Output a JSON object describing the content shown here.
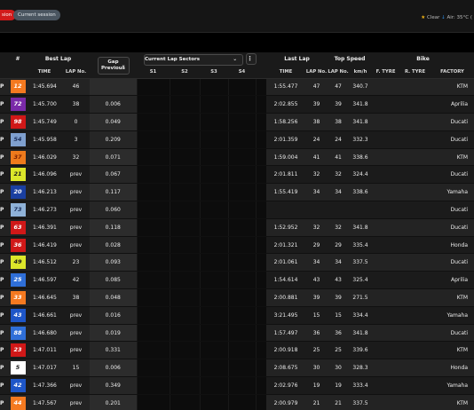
{
  "session": {
    "tag_label": "sion",
    "current_label": "Current session"
  },
  "weather": {
    "sun_icon": "★",
    "condition": "Clear",
    "rain_icon": "↓",
    "air": "Air: 35°C (",
    "colors": {
      "sun": "#f2b415",
      "rain": "#2d8fe6"
    }
  },
  "headers": {
    "number": "#",
    "best_lap": "Best Lap",
    "gap_line1": "Gap",
    "gap_line2": "Previous",
    "sectors": "Current Lap Sectors",
    "last_lap": "Last Lap",
    "top_speed": "Top Speed",
    "bike": "Bike",
    "time": "TIME",
    "lap_no": "LAP No.",
    "s1": "S1",
    "s2": "S2",
    "s3": "S3",
    "s4": "S4",
    "kmh": "km/h",
    "f_tyre": "F. TYRE",
    "r_tyre": "R. TYRE",
    "factory": "FACTORY"
  },
  "rows": [
    {
      "pos": "P",
      "num": "12",
      "num_bg": "#f47920",
      "num_fg": "#ffffff",
      "best": "1:45.694",
      "best_lap": "46",
      "gap": "",
      "last": "1:55.477",
      "last_lap": "47",
      "speed_lap": "47",
      "kmh": "340.7",
      "factory": "KTM"
    },
    {
      "pos": "P",
      "num": "72",
      "num_bg": "#7a2aa8",
      "num_fg": "#ffffff",
      "best": "1:45.700",
      "best_lap": "38",
      "gap": "0.006",
      "last": "2:02.855",
      "last_lap": "39",
      "speed_lap": "39",
      "kmh": "341.8",
      "factory": "Aprilia"
    },
    {
      "pos": "P",
      "num": "98",
      "num_bg": "#d01818",
      "num_fg": "#ffffff",
      "best": "1:45.749",
      "best_lap": "0",
      "gap": "0.049",
      "last": "1:58.256",
      "last_lap": "38",
      "speed_lap": "38",
      "kmh": "341.8",
      "factory": "Ducati"
    },
    {
      "pos": "P",
      "num": "54",
      "num_bg": "#7fa0cf",
      "num_fg": "#1a2d5a",
      "best": "1:45.958",
      "best_lap": "3",
      "gap": "0.209",
      "last": "2:01.359",
      "last_lap": "24",
      "speed_lap": "24",
      "kmh": "332.3",
      "factory": "Ducati"
    },
    {
      "pos": "P",
      "num": "37",
      "num_bg": "#ee7a1c",
      "num_fg": "#7a1f00",
      "best": "1:46.029",
      "best_lap": "32",
      "gap": "0.071",
      "last": "1:59.004",
      "last_lap": "41",
      "speed_lap": "41",
      "kmh": "338.6",
      "factory": "KTM"
    },
    {
      "pos": "P",
      "num": "21",
      "num_bg": "#dce62a",
      "num_fg": "#1a1a1a",
      "best": "1:46.096",
      "best_lap": "prev",
      "gap": "0.067",
      "last": "2:01.811",
      "last_lap": "32",
      "speed_lap": "32",
      "kmh": "324.4",
      "factory": "Ducati"
    },
    {
      "pos": "P",
      "num": "20",
      "num_bg": "#1a3fa0",
      "num_fg": "#ffffff",
      "best": "1:46.213",
      "best_lap": "prev",
      "gap": "0.117",
      "last": "1:55.419",
      "last_lap": "34",
      "speed_lap": "34",
      "kmh": "338.6",
      "factory": "Yamaha"
    },
    {
      "pos": "P",
      "num": "73",
      "num_bg": "#8fb2d8",
      "num_fg": "#1a2d5a",
      "best": "1:46.273",
      "best_lap": "prev",
      "gap": "0.060",
      "last": "",
      "last_lap": "",
      "speed_lap": "",
      "kmh": "",
      "factory": "Ducati"
    },
    {
      "pos": "P",
      "num": "63",
      "num_bg": "#d01818",
      "num_fg": "#ffffff",
      "best": "1:46.391",
      "best_lap": "prev",
      "gap": "0.118",
      "last": "1:52.952",
      "last_lap": "32",
      "speed_lap": "32",
      "kmh": "341.8",
      "factory": "Ducati"
    },
    {
      "pos": "P",
      "num": "36",
      "num_bg": "#d01818",
      "num_fg": "#ffffff",
      "best": "1:46.419",
      "best_lap": "prev",
      "gap": "0.028",
      "last": "2:01.321",
      "last_lap": "29",
      "speed_lap": "29",
      "kmh": "335.4",
      "factory": "Honda"
    },
    {
      "pos": "P",
      "num": "49",
      "num_bg": "#dce62a",
      "num_fg": "#1a1a1a",
      "best": "1:46.512",
      "best_lap": "23",
      "gap": "0.093",
      "last": "2:01.061",
      "last_lap": "34",
      "speed_lap": "34",
      "kmh": "337.5",
      "factory": "Ducati"
    },
    {
      "pos": "P",
      "num": "25",
      "num_bg": "#2f6fd8",
      "num_fg": "#ffffff",
      "best": "1:46.597",
      "best_lap": "42",
      "gap": "0.085",
      "last": "1:54.614",
      "last_lap": "43",
      "speed_lap": "43",
      "kmh": "325.4",
      "factory": "Aprilia"
    },
    {
      "pos": "P",
      "num": "33",
      "num_bg": "#f47920",
      "num_fg": "#ffffff",
      "best": "1:46.645",
      "best_lap": "38",
      "gap": "0.048",
      "last": "2:00.881",
      "last_lap": "39",
      "speed_lap": "39",
      "kmh": "271.5",
      "factory": "KTM"
    },
    {
      "pos": "P",
      "num": "43",
      "num_bg": "#1e56c8",
      "num_fg": "#ffffff",
      "best": "1:46.661",
      "best_lap": "prev",
      "gap": "0.016",
      "last": "3:21.495",
      "last_lap": "15",
      "speed_lap": "15",
      "kmh": "334.4",
      "factory": "Yamaha"
    },
    {
      "pos": "P",
      "num": "88",
      "num_bg": "#2f6fd8",
      "num_fg": "#ffffff",
      "best": "1:46.680",
      "best_lap": "prev",
      "gap": "0.019",
      "last": "1:57.497",
      "last_lap": "36",
      "speed_lap": "36",
      "kmh": "341.8",
      "factory": "Ducati"
    },
    {
      "pos": "P",
      "num": "23",
      "num_bg": "#d01818",
      "num_fg": "#ffffff",
      "best": "1:47.011",
      "best_lap": "prev",
      "gap": "0.331",
      "last": "2:00.918",
      "last_lap": "25",
      "speed_lap": "25",
      "kmh": "339.6",
      "factory": "KTM"
    },
    {
      "pos": "P",
      "num": "5",
      "num_bg": "#ffffff",
      "num_fg": "#1a1a1a",
      "best": "1:47.017",
      "best_lap": "15",
      "gap": "0.006",
      "last": "2:08.675",
      "last_lap": "30",
      "speed_lap": "30",
      "kmh": "328.3",
      "factory": "Honda"
    },
    {
      "pos": "P",
      "num": "42",
      "num_bg": "#1e56c8",
      "num_fg": "#ffffff",
      "best": "1:47.366",
      "best_lap": "prev",
      "gap": "0.349",
      "last": "2:02.976",
      "last_lap": "19",
      "speed_lap": "19",
      "kmh": "333.4",
      "factory": "Yamaha"
    },
    {
      "pos": "P",
      "num": "44",
      "num_bg": "#f47920",
      "num_fg": "#ffffff",
      "best": "1:47.567",
      "best_lap": "prev",
      "gap": "0.201",
      "last": "2:00.979",
      "last_lap": "21",
      "speed_lap": "21",
      "kmh": "337.5",
      "factory": "KTM"
    }
  ]
}
